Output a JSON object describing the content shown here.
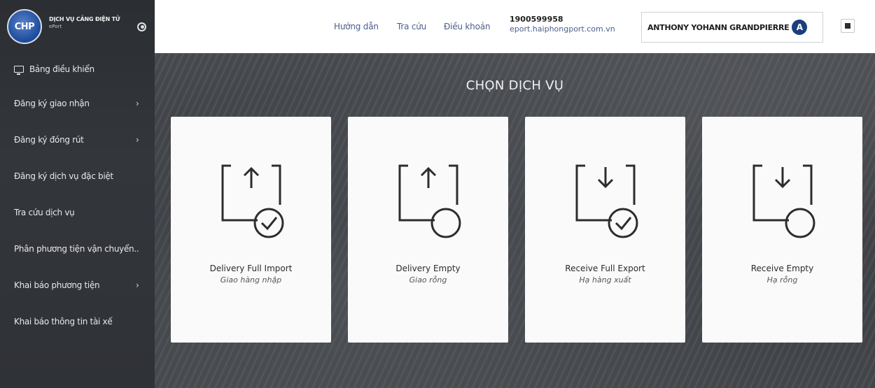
{
  "brand": {
    "logo_text": "CHP",
    "title": "DỊCH VỤ CẢNG ĐIỆN TỬ",
    "subtitle": "ePort"
  },
  "sidebar": {
    "items": [
      {
        "label": "Bảng điều khiển",
        "icon": "monitor-icon",
        "has_arrow": false
      },
      {
        "label": "Đăng ký giao nhận",
        "has_arrow": true
      },
      {
        "label": "Đăng ký đóng rút",
        "has_arrow": true
      },
      {
        "label": "Đăng ký dịch vụ đặc biệt",
        "has_arrow": false
      },
      {
        "label": "Tra cứu dịch vụ",
        "has_arrow": false
      },
      {
        "label": "Phân phương tiện vận chuyển..",
        "has_arrow": false
      },
      {
        "label": "Khai báo phương tiện",
        "has_arrow": true
      },
      {
        "label": "Khai báo thông tin tài xế",
        "has_arrow": false
      }
    ],
    "arrow": "›"
  },
  "header": {
    "links": [
      "Hướng dẫn",
      "Tra cứu",
      "Điều khoản"
    ],
    "hotline": "1900599958",
    "website": "eport.haiphongport.com.vn",
    "user_name": "ANTHONY YOHANN GRANDPIERRE",
    "avatar_letter": "A"
  },
  "main": {
    "title": "CHỌN DỊCH VỤ",
    "cards": [
      {
        "title": "Delivery Full Import",
        "subtitle": "Giao hàng nhập",
        "icon": "upload-doc-check-icon"
      },
      {
        "title": "Delivery Empty",
        "subtitle": "Giao rỗng",
        "icon": "upload-doc-empty-icon"
      },
      {
        "title": "Receive Full Export",
        "subtitle": "Hạ hàng xuất",
        "icon": "download-doc-check-icon"
      },
      {
        "title": "Receive Empty",
        "subtitle": "Hạ rỗng",
        "icon": "download-doc-empty-icon"
      }
    ]
  },
  "colors": {
    "sidebar_bg": "#2f3236",
    "header_bg": "#ffffff",
    "link": "#4a5f88",
    "avatar_bg": "#1b3f7c",
    "card_bg": "#fafafa"
  }
}
